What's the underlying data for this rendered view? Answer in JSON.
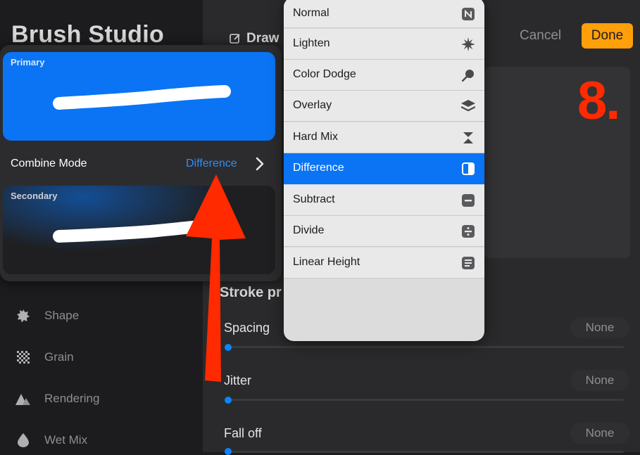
{
  "app": {
    "title": "Brush Studio"
  },
  "header": {
    "active_tab": "Draw",
    "cancel_label": "Cancel",
    "done_label": "Done"
  },
  "annotation": {
    "step_number": "8.",
    "arrow_color": "#ff2a00"
  },
  "combine_card": {
    "primary_label": "Primary",
    "secondary_label": "Secondary",
    "combine_mode_label": "Combine Mode",
    "combine_mode_value": "Difference"
  },
  "sidebar": {
    "items": [
      {
        "label": "Shape",
        "icon": "shape-icon"
      },
      {
        "label": "Grain",
        "icon": "grain-icon"
      },
      {
        "label": "Rendering",
        "icon": "rendering-icon"
      },
      {
        "label": "Wet Mix",
        "icon": "wet-mix-icon"
      }
    ]
  },
  "stroke_properties": {
    "header": "Stroke pr",
    "rows": [
      {
        "label": "Spacing",
        "value": "None"
      },
      {
        "label": "Jitter",
        "value": "None"
      },
      {
        "label": "Fall off",
        "value": "None"
      }
    ]
  },
  "blend_menu": {
    "selected": "Difference",
    "items": [
      {
        "label": "Normal",
        "icon": "normal-n-icon"
      },
      {
        "label": "Lighten",
        "icon": "lighten-burst-icon"
      },
      {
        "label": "Color Dodge",
        "icon": "color-dodge-icon"
      },
      {
        "label": "Overlay",
        "icon": "overlay-layers-icon"
      },
      {
        "label": "Hard Mix",
        "icon": "hard-mix-icon"
      },
      {
        "label": "Difference",
        "icon": "difference-icon"
      },
      {
        "label": "Subtract",
        "icon": "subtract-icon"
      },
      {
        "label": "Divide",
        "icon": "divide-icon"
      },
      {
        "label": "Linear Height",
        "icon": "linear-height-icon"
      }
    ]
  },
  "colors": {
    "accent": "#0a74f5",
    "done": "#ff9f0a",
    "annotation": "#ff2a00"
  }
}
